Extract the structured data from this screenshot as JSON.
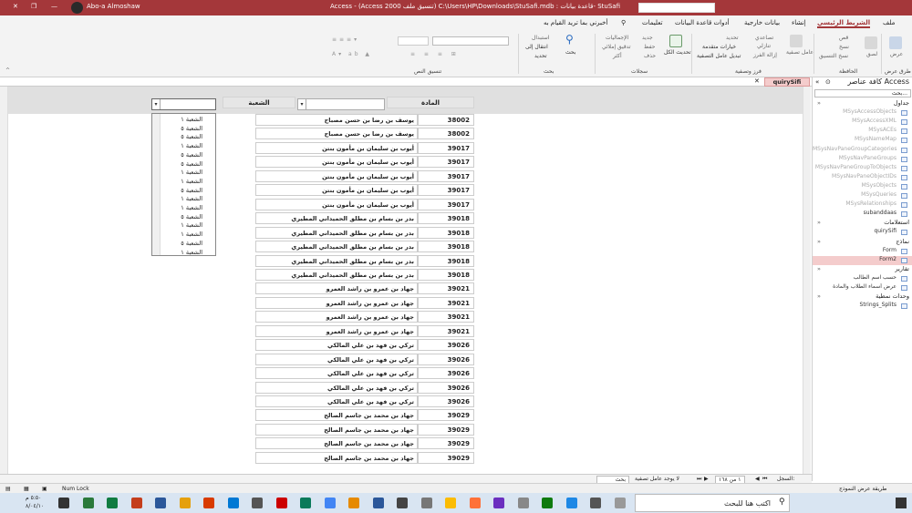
{
  "titlebar": {
    "user": "Abo-a Almoshaw",
    "title": "Access - (Access 2000 تنسيق ملف) C:\\Users\\HP\\Downloads\\StuSafi.mdb : قاعدة بيانات- StuSafi",
    "controls": "?  —  ❐  ✕"
  },
  "tabs": {
    "file": "ملف",
    "home": "الشريط الرئيسي",
    "create": "إنشاء",
    "external": "بيانات خارجية",
    "dbtools": "أدوات قاعدة البيانات",
    "help": "تعليمات",
    "tell": "أخبرني بما تريد القيام به"
  },
  "ribbon": {
    "views": {
      "view": "عرض",
      "group": "طرق عرض"
    },
    "clipboard": {
      "paste": "لصق",
      "cut": "قص",
      "copy": "نسخ",
      "painter": "نسخ التنسيق",
      "group": "الحافظة"
    },
    "sort": {
      "filter": "عامل تصفية",
      "asc": "تصاعدي",
      "desc": "تنازلي",
      "remove": "إزالة الفرز",
      "selection": "تحديد",
      "advanced": "خيارات متقدمة",
      "toggle": "تبديل عامل التصفية",
      "group": "فرز وتصفية"
    },
    "records": {
      "refresh": "تحديث الكل",
      "new": "جديد",
      "save": "حفظ",
      "delete": "حذف",
      "totals": "الإجماليات",
      "spelling": "تدقيق إملائي",
      "more": "أكثر",
      "group": "سجلات"
    },
    "find": {
      "find": "بحث",
      "replace": "استبدال",
      "goto": "انتقال إلى",
      "select": "تحديد",
      "group": "بحث"
    },
    "text": {
      "group": "تنسيق النص"
    }
  },
  "navpane": {
    "title": "كافة عناصر Access",
    "search_placeholder": "بحث...",
    "items": [
      {
        "type": "sec",
        "label": "جداول"
      },
      {
        "type": "sys",
        "label": "MSysAccessObjects"
      },
      {
        "type": "sys",
        "label": "MSysAccessXML"
      },
      {
        "type": "sys",
        "label": "MSysACEs"
      },
      {
        "type": "sys",
        "label": "MSysNameMap"
      },
      {
        "type": "sys",
        "label": "MSysNavPaneGroupCategories"
      },
      {
        "type": "sys",
        "label": "MSysNavPaneGroups"
      },
      {
        "type": "sys",
        "label": "MSysNavPaneGroupToObjects"
      },
      {
        "type": "sys",
        "label": "MSysNavPaneObjectIDs"
      },
      {
        "type": "sys",
        "label": "MSysObjects"
      },
      {
        "type": "sys",
        "label": "MSysQueries"
      },
      {
        "type": "sys",
        "label": "MSysRelationships"
      },
      {
        "type": "obj",
        "label": "subanddaas"
      },
      {
        "type": "sec",
        "label": "استعلامات"
      },
      {
        "type": "obj",
        "label": "quirySifi"
      },
      {
        "type": "sec",
        "label": "نماذج"
      },
      {
        "type": "obj",
        "label": "Form"
      },
      {
        "type": "sel",
        "label": "Form2"
      },
      {
        "type": "sec",
        "label": "تقارير"
      },
      {
        "type": "obj",
        "label": "حسب اسم الطالب"
      },
      {
        "type": "obj",
        "label": "عرض أسماء الطلاب والمادة"
      },
      {
        "type": "sec",
        "label": "وحدات نمطية"
      },
      {
        "type": "obj",
        "label": "Strings_Splits"
      }
    ]
  },
  "doctab": {
    "label": "quirySifi"
  },
  "form": {
    "header": {
      "subject_label": "المادة",
      "section_label": "الشعبة"
    },
    "dropdown": [
      "الشعبة ١",
      "الشعبة ٥",
      "الشعبة ٥",
      "الشعبة ١",
      "الشعبة ٥",
      "الشعبة ٥",
      "الشعبة ١",
      "الشعبة ١",
      "الشعبة ٥",
      "الشعبة ١",
      "الشعبة ١",
      "الشعبة ٥",
      "الشعبة ١",
      "الشعبة ١",
      "الشعبة ٥",
      "الشعبة ١"
    ],
    "rows": [
      {
        "id": "38002",
        "name": "يوسف بن رضا بن حسن مصباح"
      },
      {
        "id": "38002",
        "name": "يوسف بن رضا بن حسن مصباح"
      },
      {
        "id": "39017",
        "name": "أيوب بن سليمان بن مأمون بنتن"
      },
      {
        "id": "39017",
        "name": "أيوب بن سليمان بن مأمون بنتن"
      },
      {
        "id": "39017",
        "name": "أيوب بن سليمان بن مأمون بنتن"
      },
      {
        "id": "39017",
        "name": "أيوب بن سليمان بن مأمون بنتن"
      },
      {
        "id": "39017",
        "name": "أيوب بن سليمان بن مأمون بنتن"
      },
      {
        "id": "39018",
        "name": "بدر بن بسام بن مطلق الحميداني المطيري"
      },
      {
        "id": "39018",
        "name": "بدر بن بسام بن مطلق الحميداني المطيري"
      },
      {
        "id": "39018",
        "name": "بدر بن بسام بن مطلق الحميداني المطيري"
      },
      {
        "id": "39018",
        "name": "بدر بن بسام بن مطلق الحميداني المطيري"
      },
      {
        "id": "39018",
        "name": "بدر بن بسام بن مطلق الحميداني المطيري"
      },
      {
        "id": "39021",
        "name": "جهاد بن عمرو بن راشد العمرو"
      },
      {
        "id": "39021",
        "name": "جهاد بن عمرو بن راشد العمرو"
      },
      {
        "id": "39021",
        "name": "جهاد بن عمرو بن راشد العمرو"
      },
      {
        "id": "39021",
        "name": "جهاد بن عمرو بن راشد العمرو"
      },
      {
        "id": "39026",
        "name": "تركي بن فهد بن علي المالكي"
      },
      {
        "id": "39026",
        "name": "تركي بن فهد بن علي المالكي"
      },
      {
        "id": "39026",
        "name": "تركي بن فهد بن علي المالكي"
      },
      {
        "id": "39026",
        "name": "تركي بن فهد بن علي المالكي"
      },
      {
        "id": "39026",
        "name": "تركي بن فهد بن علي المالكي"
      },
      {
        "id": "39029",
        "name": "جهاد بن محمد بن جاسم الصالح"
      },
      {
        "id": "39029",
        "name": "جهاد بن محمد بن جاسم الصالح"
      },
      {
        "id": "39029",
        "name": "جهاد بن محمد بن جاسم الصالح"
      },
      {
        "id": "39029",
        "name": "جهاد بن محمد بن جاسم الصالح"
      }
    ]
  },
  "recnav": {
    "label": "السجل:",
    "position": "١ من ١٦٨",
    "nofilter": "لا يوجد عامل تصفية",
    "search": "بحث"
  },
  "statusbar": {
    "view": "طريقة عرض النموذج",
    "numlock": "Num Lock"
  },
  "taskbar": {
    "search": "اكتب هنا للبحث",
    "time": "٥:٥٠ م",
    "date": "٨/٠٤/١٠"
  }
}
